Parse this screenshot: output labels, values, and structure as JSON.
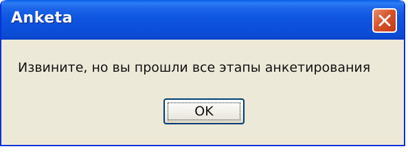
{
  "window": {
    "title": "Anketa"
  },
  "titlebar": {
    "close_icon": "close-icon"
  },
  "dialog": {
    "message": "Извините, но вы прошли все этапы анкетирования",
    "ok_label": "OK"
  },
  "colors": {
    "titlebar": "#0c4fda",
    "close_button": "#d8532c",
    "dialog_background": "#ece9d8",
    "button_border": "#003c74"
  }
}
